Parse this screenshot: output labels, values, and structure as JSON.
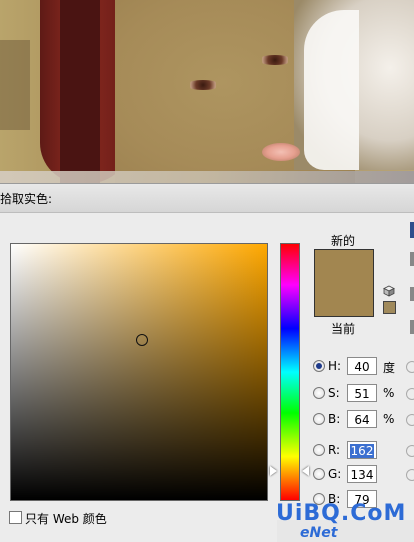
{
  "dialog": {
    "title": "拾取实色:"
  },
  "swatch": {
    "new_label": "新的",
    "current_label": "当前",
    "new_color": "#a28650",
    "current_color": "#a28650"
  },
  "values": {
    "h": {
      "label": "H:",
      "value": "40",
      "unit": "度",
      "selected": true
    },
    "s": {
      "label": "S:",
      "value": "51",
      "unit": "%",
      "selected": false
    },
    "b": {
      "label": "B:",
      "value": "64",
      "unit": "%",
      "selected": false
    },
    "r": {
      "label": "R:",
      "value": "162",
      "selected": false
    },
    "g": {
      "label": "G:",
      "value": "134",
      "selected": false
    },
    "bb": {
      "label": "B:",
      "value": "79",
      "selected": false
    }
  },
  "web_only": {
    "label": "只有 Web 颜色",
    "checked": false
  },
  "watermark": {
    "logo": "UiBQ.CoM",
    "sub": "eNet"
  },
  "colors": {
    "hue_base": "#ffa800",
    "picked": "#a28650",
    "accent": "#2d6bd6"
  }
}
